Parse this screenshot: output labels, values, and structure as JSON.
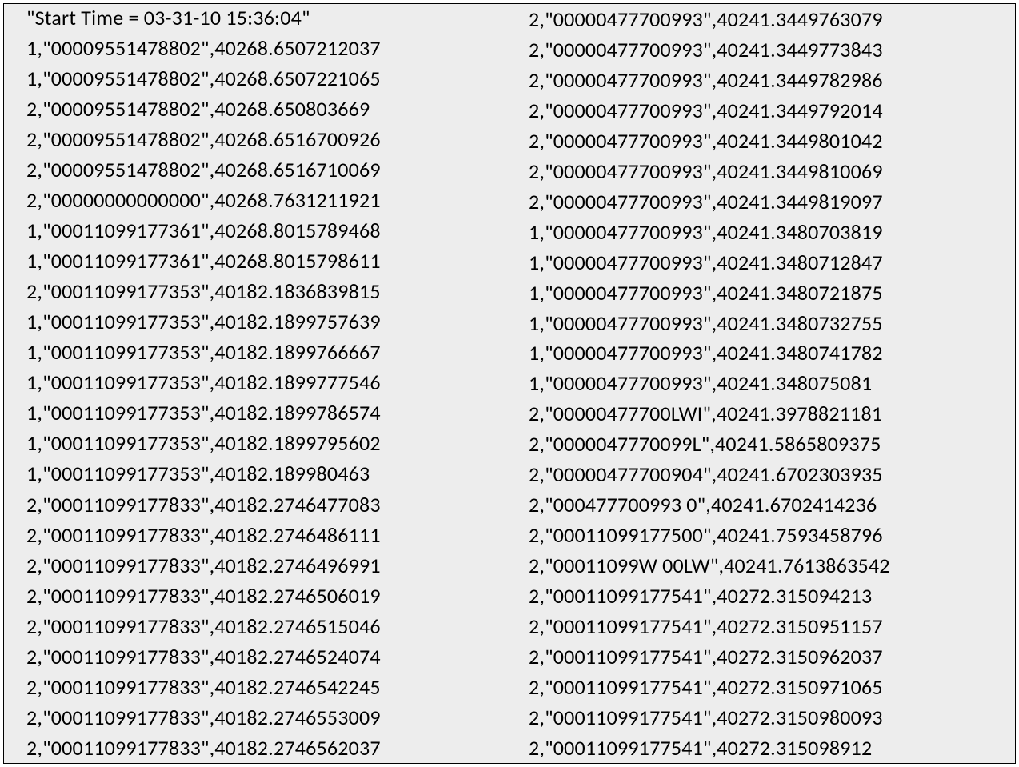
{
  "header": "\"Start Time = 03-31-10 15:36:04\"",
  "leftColumn": [
    "1,\"00009551478802\",40268.6507212037",
    "1,\"00009551478802\",40268.6507221065",
    "2,\"00009551478802\",40268.650803669",
    "2,\"00009551478802\",40268.6516700926",
    "2,\"00009551478802\",40268.6516710069",
    "2,\"00000000000000\",40268.7631211921",
    "1,\"00011099177361\",40268.8015789468",
    "1,\"00011099177361\",40268.8015798611",
    "2,\"00011099177353\",40182.1836839815",
    "1,\"00011099177353\",40182.1899757639",
    "1,\"00011099177353\",40182.1899766667",
    "1,\"00011099177353\",40182.1899777546",
    "1,\"00011099177353\",40182.1899786574",
    "1,\"00011099177353\",40182.1899795602",
    "1,\"00011099177353\",40182.189980463",
    "2,\"00011099177833\",40182.2746477083",
    "2,\"00011099177833\",40182.2746486111",
    "2,\"00011099177833\",40182.2746496991",
    "2,\"00011099177833\",40182.2746506019",
    "2,\"00011099177833\",40182.2746515046",
    "2,\"00011099177833\",40182.2746524074",
    "2,\"00011099177833\",40182.2746542245",
    "2,\"00011099177833\",40182.2746553009",
    "2,\"00011099177833\",40182.2746562037"
  ],
  "rightColumn": [
    "2,\"00000477700993\",40241.3449763079",
    "2,\"00000477700993\",40241.3449773843",
    "2,\"00000477700993\",40241.3449782986",
    "2,\"00000477700993\",40241.3449792014",
    "2,\"00000477700993\",40241.3449801042",
    "2,\"00000477700993\",40241.3449810069",
    "2,\"00000477700993\",40241.3449819097",
    "1,\"00000477700993\",40241.3480703819",
    "1,\"00000477700993\",40241.3480712847",
    "1,\"00000477700993\",40241.3480721875",
    "1,\"00000477700993\",40241.3480732755",
    "1,\"00000477700993\",40241.3480741782",
    "1,\"00000477700993\",40241.348075081",
    "2,\"00000477700LWI\",40241.3978821181",
    "2,\"0000047770099L\",40241.5865809375",
    "2,\"00000477700904\",40241.6702303935",
    "2,\"000477700993 0\",40241.6702414236",
    "2,\"00011099177500\",40241.7593458796",
    "2,\"00011099W 00LW\",40241.7613863542",
    "2,\"00011099177541\",40272.315094213",
    "2,\"00011099177541\",40272.3150951157",
    "2,\"00011099177541\",40272.3150962037",
    "2,\"00011099177541\",40272.3150971065",
    "2,\"00011099177541\",40272.3150980093",
    "2,\"00011099177541\",40272.315098912"
  ]
}
